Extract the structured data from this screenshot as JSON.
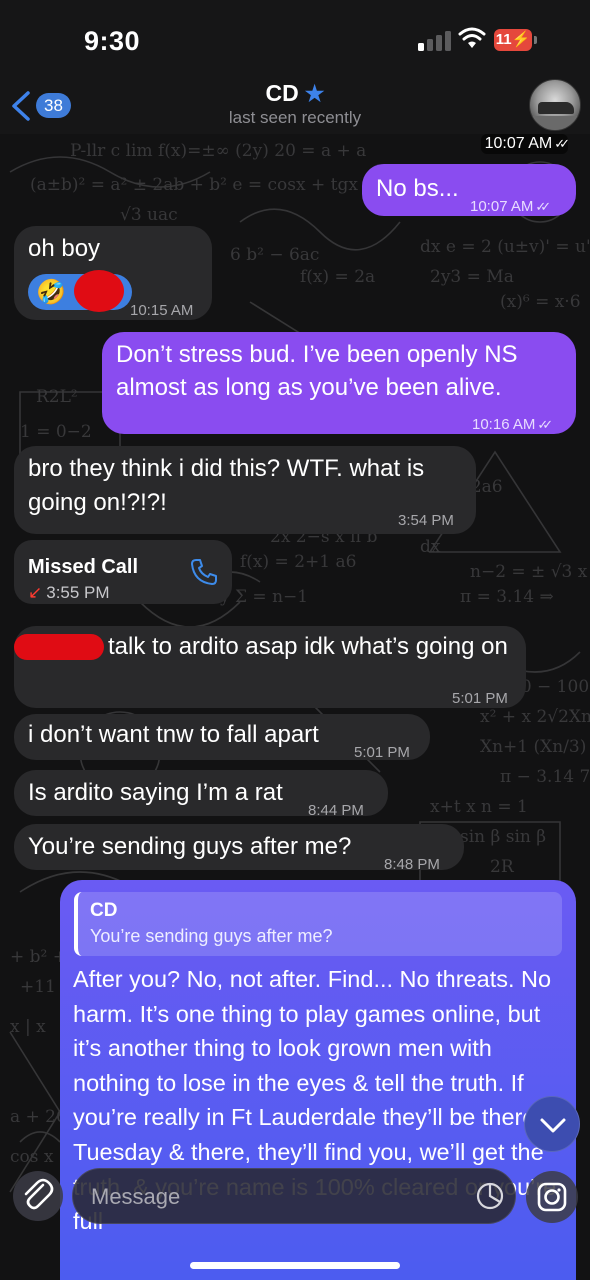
{
  "status_bar": {
    "time": "9:30",
    "battery": "11"
  },
  "header": {
    "back_count": "38",
    "contact_name": "CD",
    "contact_status": "last seen recently"
  },
  "messages": [
    {
      "type": "outgoing",
      "text": "",
      "time": "10:07 AM"
    },
    {
      "type": "outgoing",
      "text": "No bs...",
      "time": "10:07 AM"
    },
    {
      "type": "incoming",
      "text": "oh boy",
      "time": "10:15 AM"
    },
    {
      "type": "outgoing",
      "text": "Don’t stress bud.  I’ve been openly NS almost as long as you’ve been alive.",
      "time": "10:16 AM"
    },
    {
      "type": "incoming",
      "text": "bro they think i did this? WTF. what is going on!?!?!",
      "time": "3:54 PM"
    },
    {
      "type": "missed_call",
      "title": "Missed Call",
      "time": "3:55 PM"
    },
    {
      "type": "incoming",
      "text": "talk to ardito asap idk what’s going on",
      "time": "5:01 PM"
    },
    {
      "type": "incoming",
      "text": "i don’t want tnw to fall apart",
      "time": "5:01 PM"
    },
    {
      "type": "incoming",
      "text": "Is ardito saying I’m a rat",
      "time": "8:44 PM"
    },
    {
      "type": "incoming",
      "text": "You’re sending guys after me?",
      "time": "8:48 PM"
    },
    {
      "type": "outgoing_reply",
      "quote_name": "CD",
      "quote_text": "You’re sending guys after me?",
      "text": "After you?  No, not after.  Find...  No threats.  No harm.  It’s one thing to play games online, but it’s another thing to look grown men with nothing to lose in the eyes & tell the truth.  If you’re really in Ft Lauderdale they’ll be there Tuesday & there, they’ll find you, we’ll get the truth, & you’re name is 100% cleared or you’re full"
    }
  ],
  "input": {
    "placeholder": "Message"
  },
  "colors": {
    "outgoing": "#8a4cf0",
    "incoming": "#29292b",
    "reply": "#5a5cf2",
    "accent": "#3d82ea"
  },
  "icons": [
    "back-chevron-icon",
    "star-icon",
    "phone-icon",
    "missed-call-arrow-icon",
    "paperclip-icon",
    "sticker-clock-icon",
    "instagram-camera-icon",
    "chevron-down-icon"
  ]
}
